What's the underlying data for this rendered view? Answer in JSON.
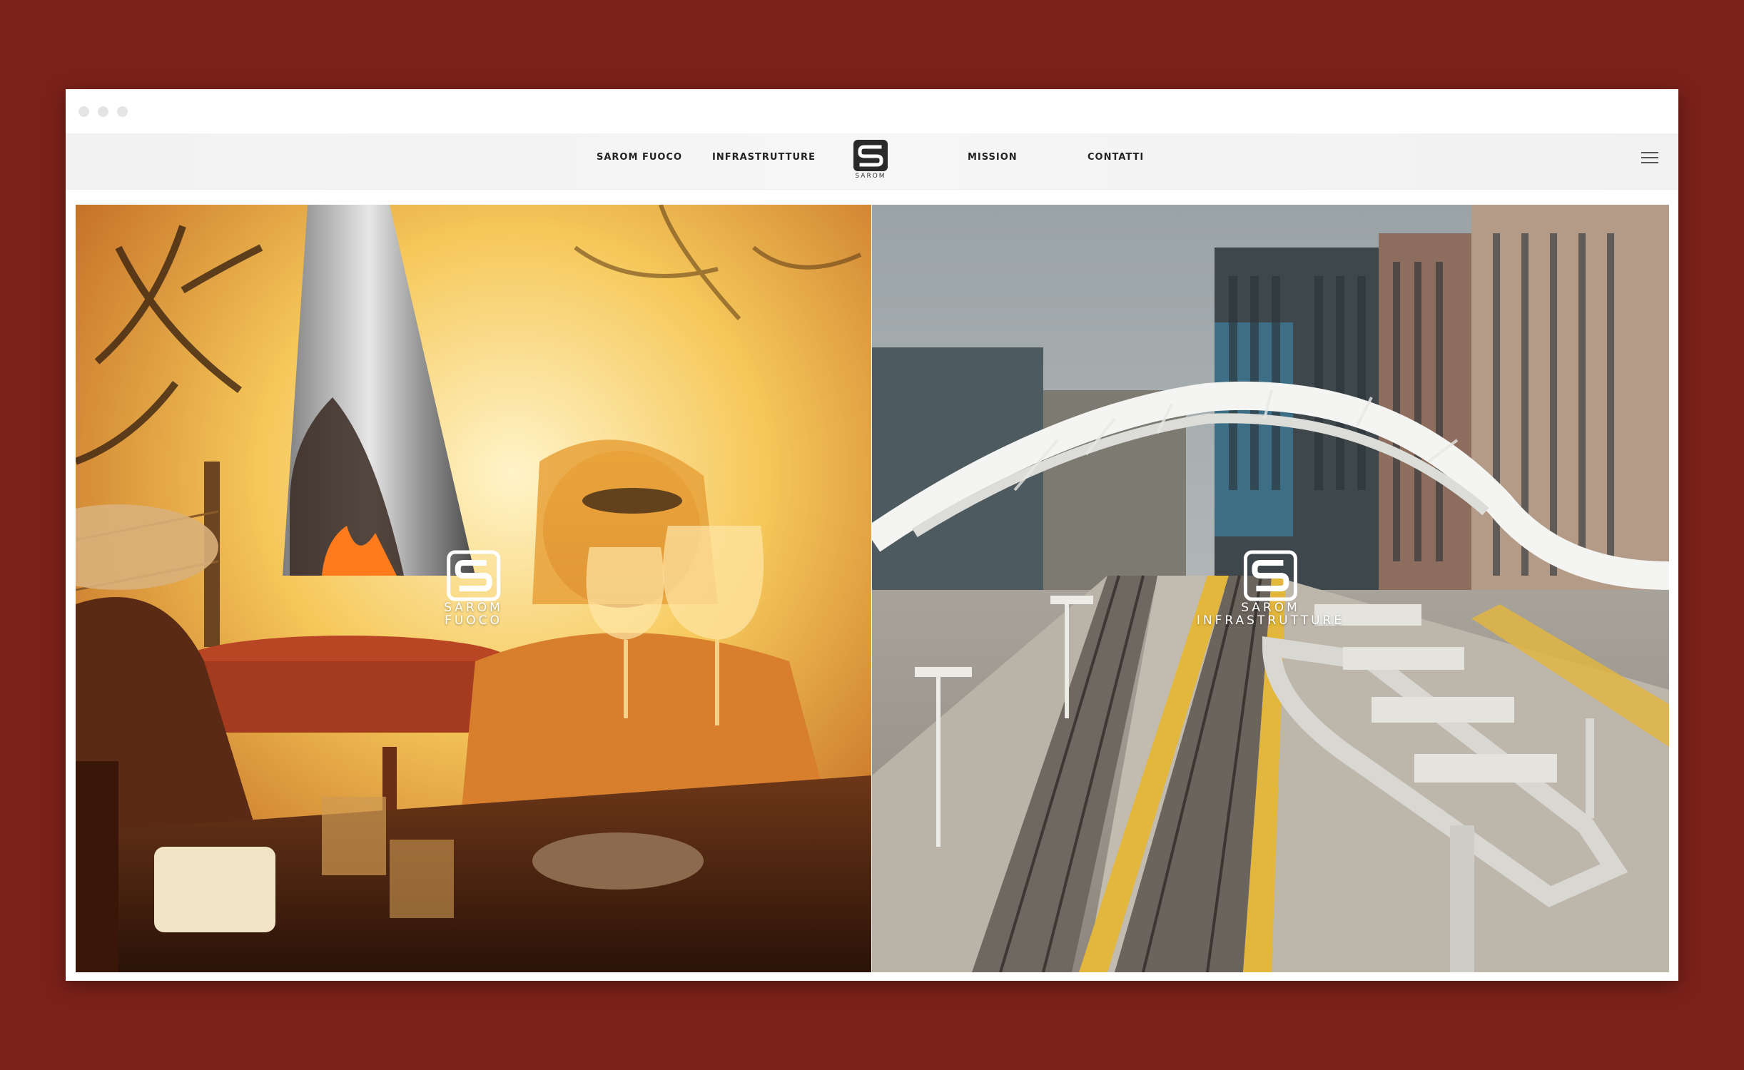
{
  "colors": {
    "page_background": "#7a2119",
    "nav_text": "#222222",
    "warm_accent": "#e8a13a",
    "platform_stripe": "#e3b63c"
  },
  "brand": {
    "logo_text": "SAROM",
    "logo_icon": "sarom-s-logo-icon"
  },
  "nav": {
    "items": [
      {
        "label": "SAROM FUOCO"
      },
      {
        "label": "INFRASTRUTTURE"
      },
      {
        "label": "MISSION"
      },
      {
        "label": "CONTATTI"
      }
    ],
    "menu_icon": "hamburger-menu-icon"
  },
  "panels": {
    "fuoco": {
      "line1": "SAROM",
      "line2": "FUOCO",
      "image": "couple toasting wine beside a stainless outdoor fireplace at sunset"
    },
    "infra": {
      "line1": "SAROM",
      "line2": "INFRASTRUTTURE",
      "image": "train station platforms with white tensile canopy and city buildings"
    }
  }
}
